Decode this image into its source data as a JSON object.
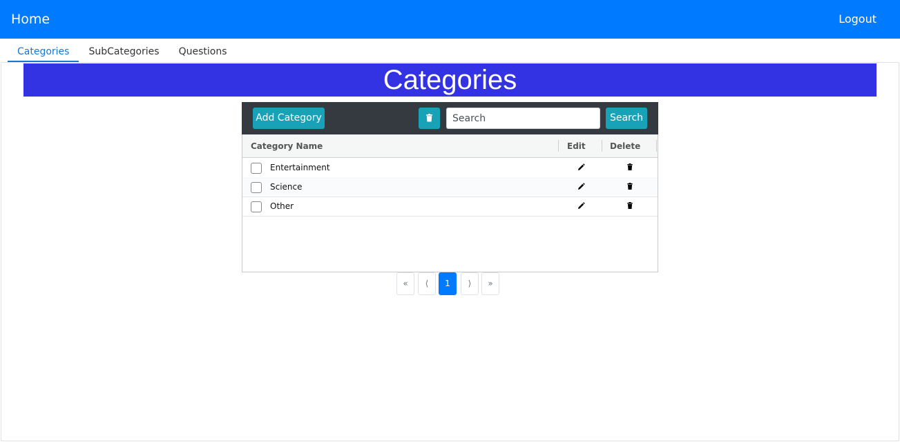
{
  "navbar": {
    "brand": "Home",
    "logout": "Logout",
    "color": "#007bff"
  },
  "tabs": [
    {
      "label": "Categories",
      "active": true
    },
    {
      "label": "SubCategories",
      "active": false
    },
    {
      "label": "Questions",
      "active": false
    }
  ],
  "page": {
    "title": "Categories",
    "title_bg": "#3333e3"
  },
  "toolbar": {
    "add_label": "Add Category",
    "delete_icon": "trash-icon",
    "search_placeholder": "Search",
    "search_value": "",
    "search_label": "Search"
  },
  "table": {
    "columns": [
      "Category Name",
      "Edit",
      "Delete"
    ],
    "rows": [
      {
        "name": "Entertainment",
        "checked": false
      },
      {
        "name": "Science",
        "checked": false
      },
      {
        "name": "Other",
        "checked": false
      }
    ],
    "edit_icon": "pencil-icon",
    "delete_icon": "trash-icon"
  },
  "pagination": {
    "first": "«",
    "prev": "⟨",
    "current": "1",
    "next": "⟩",
    "last": "»"
  }
}
